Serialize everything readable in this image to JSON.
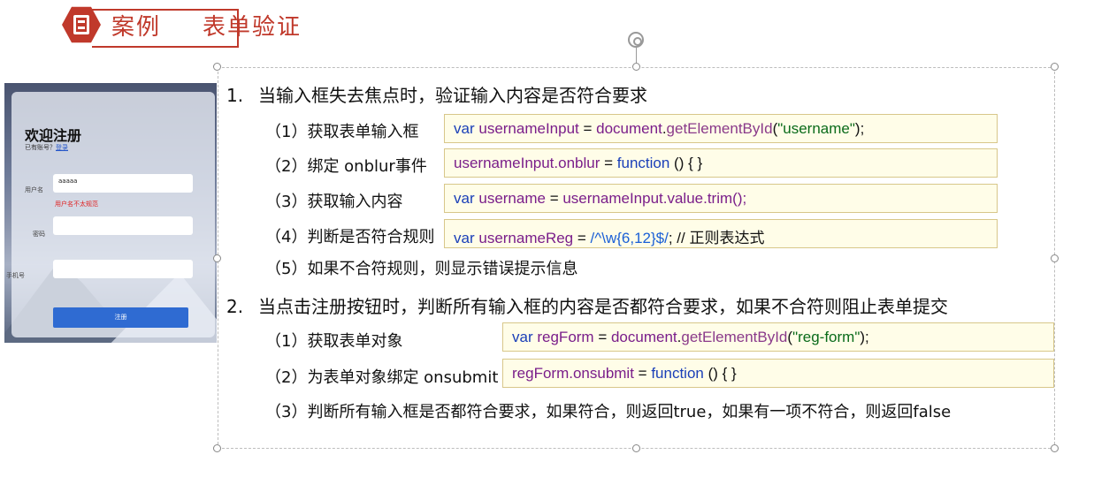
{
  "header": {
    "badge_label": "案例",
    "title": "表单验证"
  },
  "thumbnail": {
    "title": "欢迎注册",
    "subtitle_prefix": "已有账号？",
    "login_link": "登录",
    "username_label": "用户名",
    "username_value": "aaaaa",
    "username_error": "用户名不太规范",
    "password_label": "密码",
    "phone_label": "手机号",
    "submit_label": "注册"
  },
  "main": {
    "item1": {
      "num": "1.",
      "text": "当输入框失去焦点时，验证输入内容是否符合要求"
    },
    "item2": {
      "num": "2.",
      "text": "当点击注册按钮时，判断所有输入框的内容是否都符合要求，如果不合符则阻止表单提交"
    }
  },
  "steps1": [
    {
      "label": "（1）获取表单输入框"
    },
    {
      "label": "（2）绑定 onblur事件"
    },
    {
      "label": "（3）获取输入内容"
    },
    {
      "label": "（4）判断是否符合规则"
    },
    {
      "label": "（5）如果不合符规则，则显示错误提示信息"
    }
  ],
  "steps2": [
    {
      "label": "（1）获取表单对象"
    },
    {
      "label": "（2）为表单对象绑定 onsubmit"
    },
    {
      "label": "（3）判断所有输入框是否都符合要求，如果符合，则返回true，如果有一项不符合，则返回false"
    }
  ],
  "code": {
    "c1": {
      "kw": "var",
      "var": "usernameInput",
      "eq": " = ",
      "obj": "document",
      "dot": ".",
      "fn": "getElementById",
      "open": "(",
      "str": "\"username\"",
      "close": ");"
    },
    "c2": {
      "var": "usernameInput",
      "prop": ".onblur",
      "eq": " = ",
      "kw": "function",
      "rest": "  () { }"
    },
    "c3": {
      "kw": "var",
      "var": "username",
      "eq": " = ",
      "obj": "usernameInput",
      "rest": ".value.trim();"
    },
    "c4": {
      "kw": "var",
      "var": "usernameReg",
      "eq": " = ",
      "reg": "/^\\w{6,12}$/",
      "rest": "; // 正则表达式"
    },
    "c5": {
      "kw": "var",
      "var": "regForm",
      "eq": " = ",
      "obj": "document",
      "dot": ".",
      "fn": "getElementById",
      "open": "(",
      "str": "\"reg-form\"",
      "close": ");"
    },
    "c6": {
      "var": "regForm",
      "prop": ".onsubmit",
      "eq": " = ",
      "kw": "function",
      "rest": " () { }"
    }
  }
}
